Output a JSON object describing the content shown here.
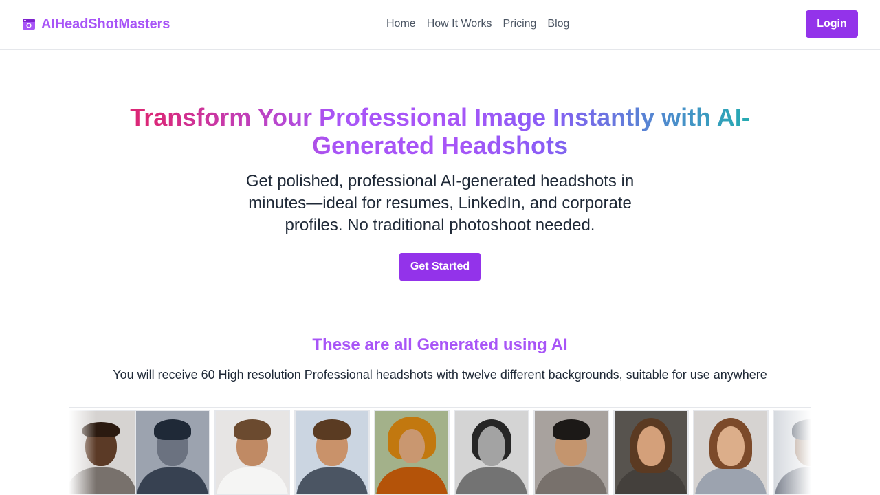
{
  "header": {
    "brand_name": "AIHeadShotMasters",
    "brand_icon": "camera-icon",
    "nav": [
      "Home",
      "How It Works",
      "Pricing",
      "Blog"
    ],
    "login_label": "Login"
  },
  "hero": {
    "title": "Transform Your Professional Image Instantly with AI-Generated Headshots",
    "subtitle": "Get polished, professional AI-generated headshots in minutes—ideal for resumes, LinkedIn, and corporate profiles. No traditional photoshoot needed.",
    "cta_label": "Get Started"
  },
  "gallery_section": {
    "title": "These are all Generated using AI",
    "subtitle": "You will receive 60 High resolution Professional headshots with twelve different backgrounds, suitable for use anywhere",
    "images": [
      {
        "name": "headshot-1"
      },
      {
        "name": "headshot-2"
      },
      {
        "name": "headshot-3"
      },
      {
        "name": "headshot-4"
      },
      {
        "name": "headshot-5"
      },
      {
        "name": "headshot-6"
      },
      {
        "name": "headshot-7"
      },
      {
        "name": "headshot-8"
      },
      {
        "name": "headshot-9"
      },
      {
        "name": "headshot-10"
      }
    ]
  },
  "colors": {
    "accent": "#9333ea",
    "brand": "#a855f7",
    "gradient": [
      "#db2777",
      "#a855f7",
      "#14b8a6"
    ]
  }
}
